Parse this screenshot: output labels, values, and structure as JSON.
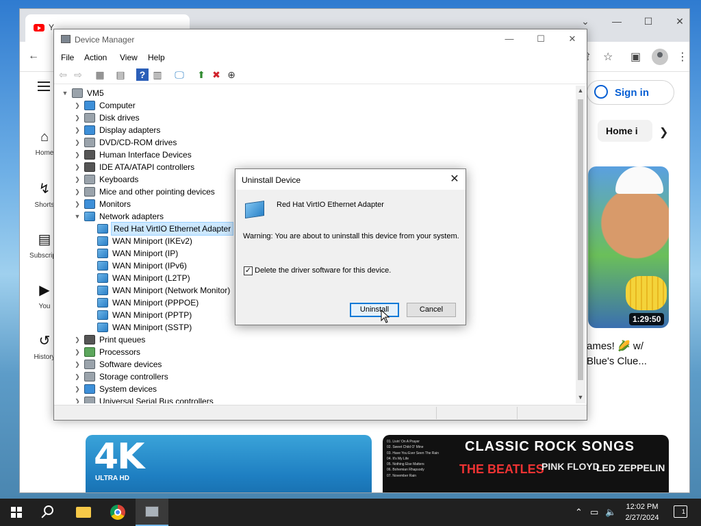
{
  "chrome": {
    "tab_title": "Y",
    "signin_label": "Sign in",
    "chip_home": "Home i",
    "nav": [
      {
        "icon": "home-icon",
        "label": "Home"
      },
      {
        "icon": "shorts-icon",
        "label": "Shorts"
      },
      {
        "icon": "subscriptions-icon",
        "label": "Subscripti"
      },
      {
        "icon": "you-icon",
        "label": "You"
      },
      {
        "icon": "history-icon",
        "label": "History"
      }
    ],
    "video": {
      "duration": "1:29:50",
      "title_line1": "ames! 🌽 w/",
      "title_line2": "Blue's Clue..."
    },
    "thumb_4k": {
      "big": "4K",
      "sub": "ULTRA HD"
    },
    "thumb_rock": {
      "title": "CLASSIC ROCK SONGS",
      "songs": [
        "01. Livin' On A Prayer",
        "02. Sweet Child O' Mine",
        "03. Have You Ever Seen The Rain",
        "04. It's My Life",
        "05. Nothing Else Matters",
        "06. Bohemian Rhapsody",
        "07. November Rain"
      ],
      "band1": "THE BEATLES",
      "band2": "PINK FLOYD",
      "band3": "LED ZEPPELIN"
    }
  },
  "devmgr": {
    "title": "Device Manager",
    "menu": [
      "File",
      "Action",
      "View",
      "Help"
    ],
    "root": "VM5",
    "categories_before": [
      "Computer",
      "Disk drives",
      "Display adapters",
      "DVD/CD-ROM drives",
      "Human Interface Devices",
      "IDE ATA/ATAPI controllers",
      "Keyboards",
      "Mice and other pointing devices",
      "Monitors"
    ],
    "network_category": "Network adapters",
    "network_children": [
      "Red Hat VirtIO Ethernet Adapter",
      "WAN Miniport (IKEv2)",
      "WAN Miniport (IP)",
      "WAN Miniport (IPv6)",
      "WAN Miniport (L2TP)",
      "WAN Miniport (Network Monitor)",
      "WAN Miniport (PPPOE)",
      "WAN Miniport (PPTP)",
      "WAN Miniport (SSTP)"
    ],
    "categories_after": [
      "Print queues",
      "Processors",
      "Software devices",
      "Storage controllers",
      "System devices",
      "Universal Serial Bus controllers"
    ]
  },
  "dialog": {
    "title": "Uninstall Device",
    "device_name": "Red Hat VirtIO Ethernet Adapter",
    "warning": "Warning: You are about to uninstall this device from your system.",
    "checkbox_label": "Delete the driver software for this device.",
    "checkbox_checked": true,
    "uninstall_label": "Uninstall",
    "cancel_label": "Cancel"
  },
  "taskbar": {
    "time": "12:02 PM",
    "date": "2/27/2024",
    "notification_count": "1"
  }
}
